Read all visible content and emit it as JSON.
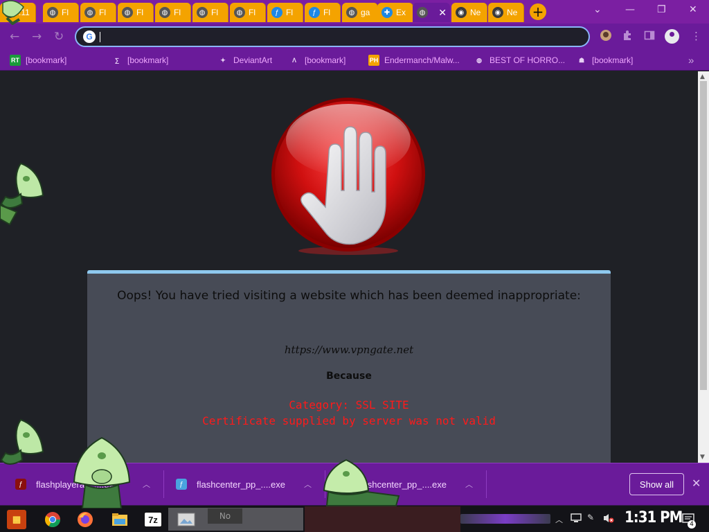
{
  "browser": {
    "tabs": [
      {
        "label": ".11",
        "icon": "chrome-icon",
        "active": false
      },
      {
        "label": "Fl",
        "icon": "globe-icon",
        "active": false
      },
      {
        "label": "Fl",
        "icon": "globe-icon",
        "active": false
      },
      {
        "label": "Fl",
        "icon": "globe-icon",
        "active": false
      },
      {
        "label": "Fl",
        "icon": "globe-icon",
        "active": false
      },
      {
        "label": "Fl",
        "icon": "globe-icon",
        "active": false
      },
      {
        "label": "Fl",
        "icon": "globe-icon",
        "active": false
      },
      {
        "label": "Fl",
        "icon": "flash-icon",
        "active": false
      },
      {
        "label": "Fl",
        "icon": "flash-icon",
        "active": false
      },
      {
        "label": "ga",
        "icon": "globe-icon",
        "active": false
      },
      {
        "label": "Ex",
        "icon": "puzzle-icon",
        "active": false
      },
      {
        "label": "",
        "icon": "globe-icon",
        "active": true
      },
      {
        "label": "Ne",
        "icon": "chrome-icon",
        "active": false
      },
      {
        "label": "Ne",
        "icon": "chrome-icon",
        "active": false
      }
    ],
    "new_tab": "+",
    "address": {
      "value": "",
      "placeholder": ""
    },
    "bookmarks": [
      {
        "label": "[bookmark]",
        "icon": "RT",
        "icon_bg": "#1a9b3a"
      },
      {
        "label": "[bookmark]",
        "icon": "∑",
        "icon_bg": "transparent"
      },
      {
        "label": "DeviantArt",
        "icon": "✦",
        "icon_bg": "transparent"
      },
      {
        "label": "[bookmark]",
        "icon": "Λ",
        "icon_bg": "transparent"
      },
      {
        "label": "Endermanch/Malw...",
        "icon": "PH",
        "icon_bg": "#f4a300"
      },
      {
        "label": "BEST OF HORRO...",
        "icon": "◍",
        "icon_bg": "transparent"
      },
      {
        "label": "[bookmark]",
        "icon": "☗",
        "icon_bg": "transparent"
      }
    ],
    "bookmarks_more": "»"
  },
  "block_page": {
    "heading": "Oops! You have tried visiting a website which has been deemed inappropriate:",
    "url": "https://www.vpngate.net",
    "because": "Because",
    "category": "Category: SSL SITE",
    "reason": "Certificate supplied by server was not valid"
  },
  "downloads": {
    "items": [
      {
        "label": "flashplayerax_....exe",
        "icon": "flash-icon"
      },
      {
        "label": "flashcenter_pp_....exe",
        "icon": "flashcenter-icon"
      },
      {
        "label": "flashcenter_pp_....exe",
        "icon": "flashcenter-icon"
      }
    ],
    "show_all": "Show all",
    "close": "✕"
  },
  "taskbar": {
    "apps": [
      "start-icon",
      "chrome-icon",
      "firefox-icon",
      "file-explorer-icon",
      "7zip-icon",
      "image-viewer-icon"
    ],
    "sevenzip_label": "7z",
    "window_label": "No",
    "clock": "1:31 PM",
    "notification_count": "4"
  },
  "colors": {
    "theme": "#6a1b9a",
    "tab": "#f4a300",
    "bookmark_text": "#f0a8ff",
    "error_text": "#ff1a1a",
    "panel": "#474b56",
    "panel_border": "#8ec8ee"
  }
}
